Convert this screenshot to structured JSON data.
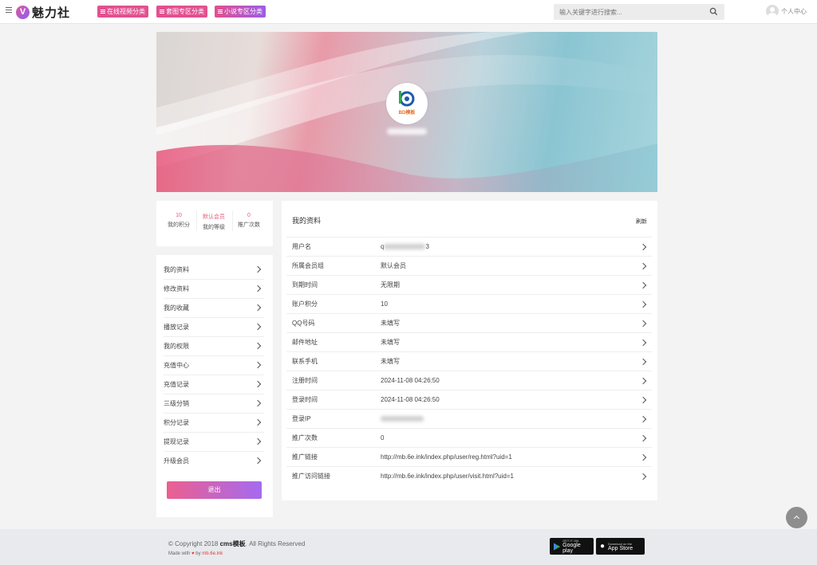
{
  "header": {
    "logo_letter": "V",
    "logo_text": "魅力社",
    "nav": [
      {
        "label": "在线视频分类",
        "color": "#e2508f"
      },
      {
        "label": "套图专区分类",
        "color": "#e2508f"
      },
      {
        "label": "小说专区分类",
        "color": "#b05cd8"
      }
    ],
    "search_placeholder": "输入关键字进行搜索...",
    "user_label": "个人中心"
  },
  "banner": {
    "avatar_text": "BD模板"
  },
  "stats": [
    {
      "value": "10",
      "label": "我的积分"
    },
    {
      "value": "默认会员",
      "label": "我的等级"
    },
    {
      "value": "0",
      "label": "推广次数"
    }
  ],
  "side_menu": {
    "items": [
      "我的资料",
      "修改资料",
      "我的收藏",
      "播放记录",
      "我的权限",
      "充值中心",
      "充值记录",
      "三级分销",
      "积分记录",
      "提现记录",
      "升级会员"
    ],
    "logout_label": "退出"
  },
  "profile": {
    "title": "我的资料",
    "refresh_label": "刷新",
    "rows": [
      {
        "key": "用户名",
        "value": "q",
        "value_suffix": "3",
        "blurred": true
      },
      {
        "key": "所属会员组",
        "value": "默认会员"
      },
      {
        "key": "到期时间",
        "value": "无限期"
      },
      {
        "key": "账户积分",
        "value": "10"
      },
      {
        "key": "QQ号码",
        "value": "未填写"
      },
      {
        "key": "邮件地址",
        "value": "未填写"
      },
      {
        "key": "联系手机",
        "value": "未填写"
      },
      {
        "key": "注册时间",
        "value": "2024-11-08 04:26:50"
      },
      {
        "key": "登录时间",
        "value": "2024-11-08 04:26:50"
      },
      {
        "key": "登录IP",
        "value": "",
        "blurred": true
      },
      {
        "key": "推广次数",
        "value": "0"
      },
      {
        "key": "推广链接",
        "value": "http://mb.6e.ink/index.php/user/reg.html?uid=1"
      },
      {
        "key": "推广访问链接",
        "value": "http://mb.6e.ink/index.php/user/visit.html?uid=1"
      }
    ]
  },
  "footer": {
    "copyright_prefix": "© Copyright 2018",
    "copyright_brand": "cms模板",
    "copyright_suffix": ". All Rights Reserved",
    "made_with": "Made with",
    "made_by": "by",
    "made_by_name": "mb.6e.ink",
    "google_small": "GET IT ON",
    "google_large": "Google play",
    "apple_small": "Download on the",
    "apple_large": "App Store"
  }
}
